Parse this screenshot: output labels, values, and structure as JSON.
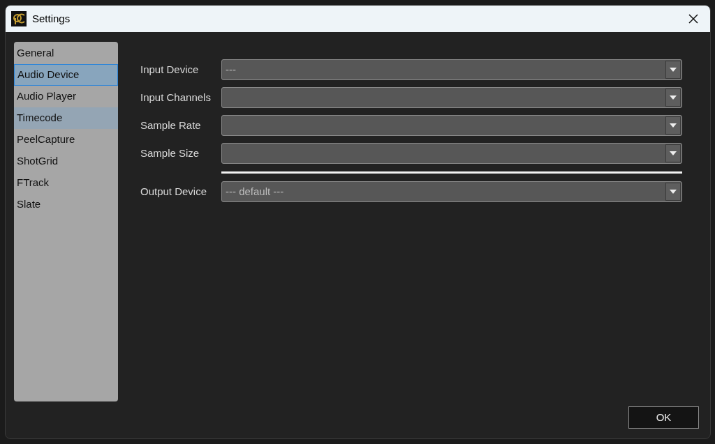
{
  "window": {
    "title": "Settings"
  },
  "sidebar": {
    "items": [
      {
        "label": "General",
        "selected": false,
        "highlighted": false
      },
      {
        "label": "Audio Device",
        "selected": true,
        "highlighted": false
      },
      {
        "label": "Audio Player",
        "selected": false,
        "highlighted": false
      },
      {
        "label": "Timecode",
        "selected": false,
        "highlighted": true
      },
      {
        "label": "PeelCapture",
        "selected": false,
        "highlighted": false
      },
      {
        "label": "ShotGrid",
        "selected": false,
        "highlighted": false
      },
      {
        "label": "FTrack",
        "selected": false,
        "highlighted": false
      },
      {
        "label": "Slate",
        "selected": false,
        "highlighted": false
      }
    ]
  },
  "form": [
    {
      "kind": "combo",
      "label": "Input Device",
      "value": "---"
    },
    {
      "kind": "combo",
      "label": "Input Channels"
    },
    {
      "kind": "combo",
      "label": "Sample Rate"
    },
    {
      "kind": "combo",
      "label": "Sample Size"
    },
    {
      "kind": "separator"
    },
    {
      "kind": "combo",
      "label": "Output Device",
      "value": "--- default ---"
    }
  ],
  "buttons": [
    "OK"
  ]
}
